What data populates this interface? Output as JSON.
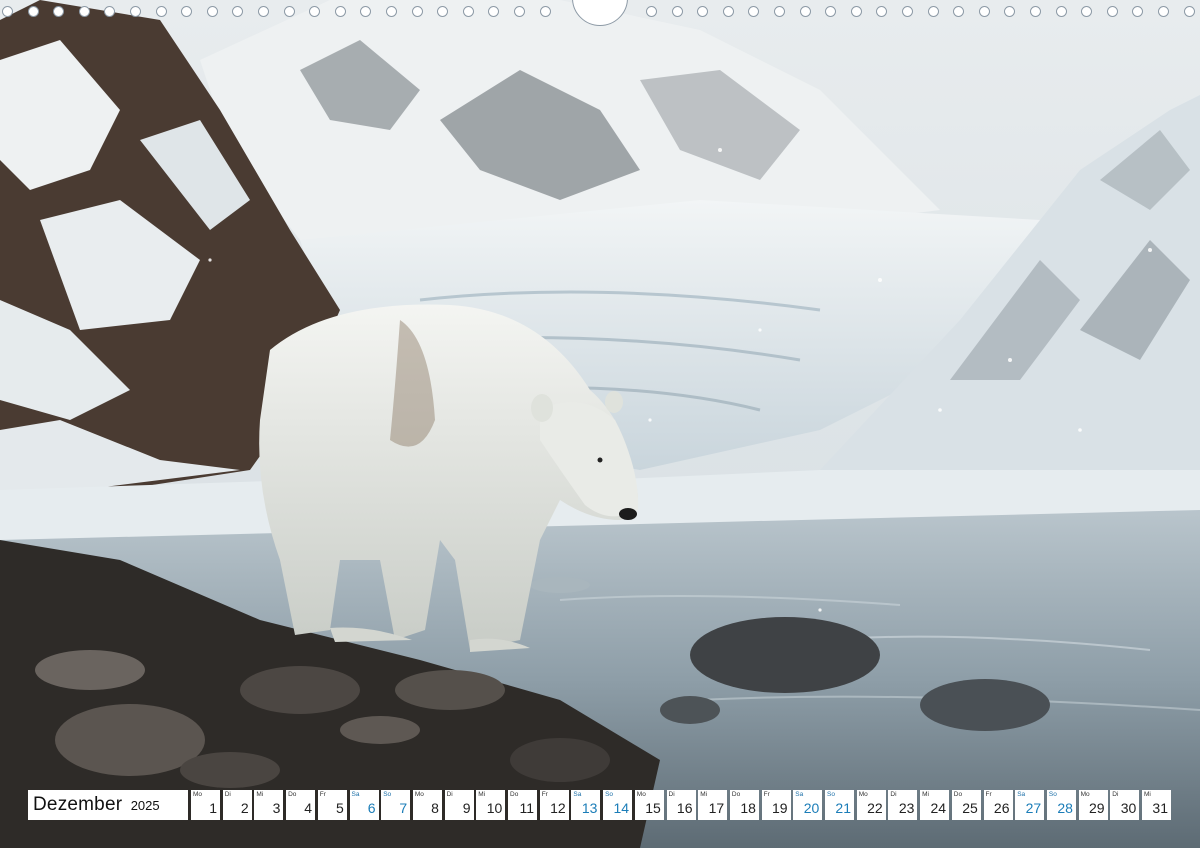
{
  "calendar": {
    "month": "Dezember",
    "year": "2025",
    "weekend_color": "#1b7db8",
    "days": [
      {
        "wd": "Mo",
        "d": "1"
      },
      {
        "wd": "Di",
        "d": "2"
      },
      {
        "wd": "Mi",
        "d": "3"
      },
      {
        "wd": "Do",
        "d": "4"
      },
      {
        "wd": "Fr",
        "d": "5"
      },
      {
        "wd": "Sa",
        "d": "6",
        "weekend": true
      },
      {
        "wd": "So",
        "d": "7",
        "weekend": true
      },
      {
        "wd": "Mo",
        "d": "8"
      },
      {
        "wd": "Di",
        "d": "9"
      },
      {
        "wd": "Mi",
        "d": "10"
      },
      {
        "wd": "Do",
        "d": "11"
      },
      {
        "wd": "Fr",
        "d": "12"
      },
      {
        "wd": "Sa",
        "d": "13",
        "weekend": true
      },
      {
        "wd": "So",
        "d": "14",
        "weekend": true
      },
      {
        "wd": "Mo",
        "d": "15"
      },
      {
        "wd": "Di",
        "d": "16"
      },
      {
        "wd": "Mi",
        "d": "17"
      },
      {
        "wd": "Do",
        "d": "18"
      },
      {
        "wd": "Fr",
        "d": "19"
      },
      {
        "wd": "Sa",
        "d": "20",
        "weekend": true
      },
      {
        "wd": "So",
        "d": "21",
        "weekend": true
      },
      {
        "wd": "Mo",
        "d": "22"
      },
      {
        "wd": "Di",
        "d": "23"
      },
      {
        "wd": "Mi",
        "d": "24"
      },
      {
        "wd": "Do",
        "d": "25"
      },
      {
        "wd": "Fr",
        "d": "26"
      },
      {
        "wd": "Sa",
        "d": "27",
        "weekend": true
      },
      {
        "wd": "So",
        "d": "28",
        "weekend": true
      },
      {
        "wd": "Mo",
        "d": "29"
      },
      {
        "wd": "Di",
        "d": "30"
      },
      {
        "wd": "Mi",
        "d": "31"
      }
    ]
  },
  "photo": {
    "subject": "polar-bear",
    "sky_color": "#dfe6ea",
    "snow_color": "#eef2f4",
    "water_color": "#9fb0bb"
  }
}
